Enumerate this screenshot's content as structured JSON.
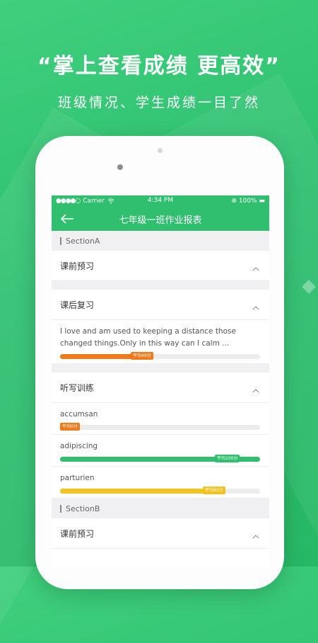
{
  "headline": "“掌上查看成绩  更高效”",
  "subline": "班级情况、学生成绩一目了然",
  "status": {
    "carrier": "Carrier",
    "time": "4:34 PM",
    "battery": "100%"
  },
  "nav": {
    "title": "七年级一班作业报表"
  },
  "colors": {
    "green": "#2fbf6e",
    "orange": "#f07a1a",
    "yellow": "#f2c21f",
    "track": "#ececec"
  },
  "sections": [
    {
      "name": "SectionA",
      "groups": [
        {
          "title": "课前预习",
          "items": []
        },
        {
          "title": "课后复习",
          "items": [
            {
              "text": "I love and am used to keeping a distance those changed things.Only in this way can I calm ...",
              "badge": "平均46分",
              "progress": 0.46,
              "color": "orange"
            }
          ]
        },
        {
          "title": "听写训练",
          "items": [
            {
              "text": "accumsan",
              "badge": "平均0分",
              "progress": 0,
              "color": "orange"
            },
            {
              "text": "adipiscing",
              "badge": "平均100分",
              "progress": 1.0,
              "color": "green"
            },
            {
              "text": "parturien",
              "badge": "平均82分",
              "progress": 0.82,
              "color": "yellow"
            }
          ]
        }
      ]
    },
    {
      "name": "SectionB",
      "groups": [
        {
          "title": "课前预习",
          "items": []
        }
      ]
    }
  ]
}
